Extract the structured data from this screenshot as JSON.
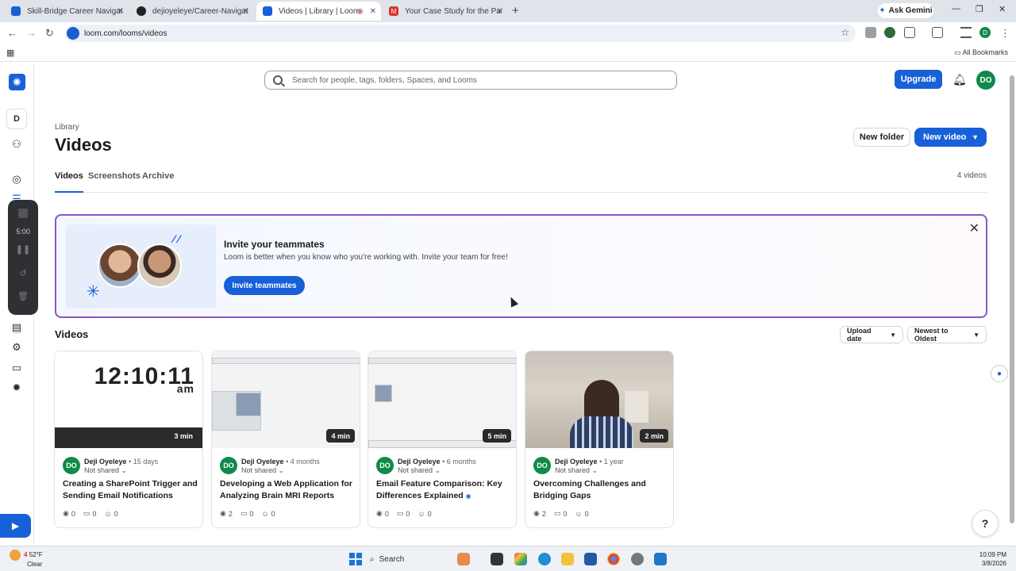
{
  "browser": {
    "tabs": [
      {
        "label": "Skill-Bridge Career Navigator",
        "active": false
      },
      {
        "label": "dejioyeleye/Career-Navigator",
        "active": false
      },
      {
        "label": "Videos | Library | Loom",
        "active": true
      },
      {
        "label": "Your Case Study for the Palo Al",
        "active": false
      }
    ],
    "ask_gemini": "Ask Gemini",
    "url": "loom.com/looms/videos",
    "profile_initials": "D",
    "all_bookmarks": "All Bookmarks"
  },
  "rail": {
    "workspace_initial": "D",
    "recorder_time": "5:00"
  },
  "topbar": {
    "search_placeholder": "Search for people, tags, folders, Spaces, and Looms",
    "upgrade_label": "Upgrade",
    "avatar_initials": "DO"
  },
  "header": {
    "breadcrumb": "Library",
    "title": "Videos",
    "new_folder_label": "New folder",
    "new_video_label": "New video",
    "tabs": [
      "Videos",
      "Screenshots",
      "Archive"
    ],
    "video_count": "4 videos"
  },
  "banner": {
    "title": "Invite your teammates",
    "description": "Loom is better when you know who you're working with. Invite your team for free!",
    "button_label": "Invite teammates"
  },
  "videos": {
    "section_title": "Videos",
    "sort_field": "Upload date",
    "sort_order": "Newest to Oldest",
    "cards": [
      {
        "duration": "3 min",
        "author": "Deji Oyeleye",
        "age": "15 days",
        "shared": "Not shared",
        "title": "Creating a SharePoint Trigger and Sending Email Notifications",
        "views": "0",
        "comments": "0",
        "reactions": "0",
        "thumb_clock": "12:10:11",
        "thumb_ampm": "am"
      },
      {
        "duration": "4 min",
        "author": "Deji Oyeleye",
        "age": "4 months",
        "shared": "Not shared",
        "title": "Developing a Web Application for Analyzing Brain MRI Reports",
        "views": "2",
        "comments": "0",
        "reactions": "0"
      },
      {
        "duration": "5 min",
        "author": "Deji Oyeleye",
        "age": "6 months",
        "shared": "Not shared",
        "title": "Email Feature Comparison: Key Differences Explained",
        "views": "0",
        "comments": "0",
        "reactions": "0"
      },
      {
        "duration": "2 min",
        "author": "Deji Oyeleye",
        "age": "1 year",
        "shared": "Not shared",
        "title": "Overcoming Challenges and Bridging Gaps",
        "views": "2",
        "comments": "0",
        "reactions": "0"
      }
    ]
  },
  "taskbar": {
    "temperature": "52°F",
    "condition": "Clear",
    "weather_badge": "4",
    "search_label": "Search",
    "time": "10:09 PM",
    "date": "3/8/2026"
  },
  "colors": {
    "accent": "#1760d8",
    "avatar_green": "#0f8a48",
    "banner_border": "#8a57c9"
  }
}
